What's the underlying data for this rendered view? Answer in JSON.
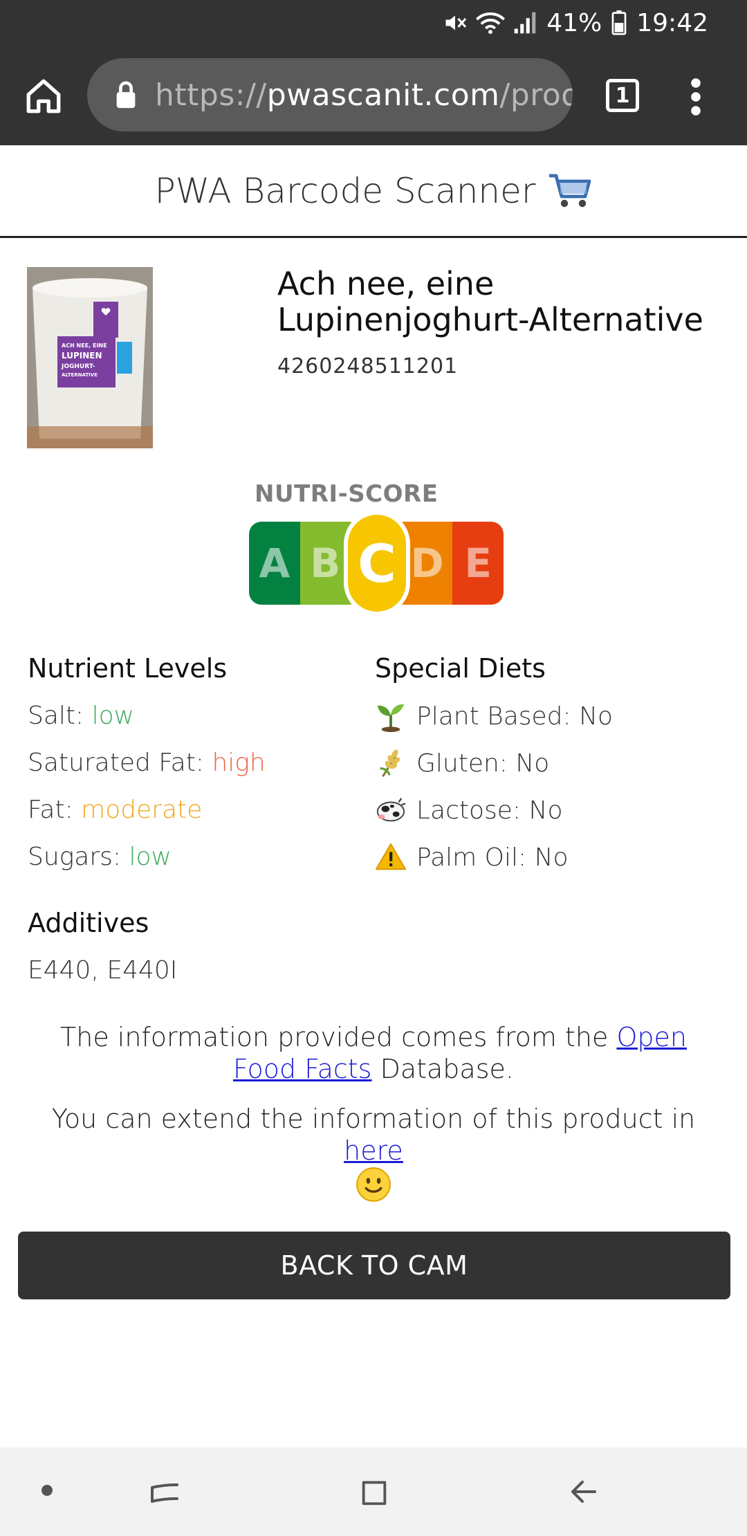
{
  "status_bar": {
    "battery": "41%",
    "time": "19:42"
  },
  "browser": {
    "url_scheme": "https://",
    "url_host": "pwascanit.com",
    "url_path": "/prod",
    "tab_count": "1"
  },
  "app": {
    "title": "PWA Barcode Scanner"
  },
  "product": {
    "name": "Ach nee, eine Lupinenjoghurt-Alternative",
    "code": "4260248511201",
    "thumb_text": "ACH NEE, EINE LUPINEN JOGHURT-ALTERNATIVE"
  },
  "nutriscore": {
    "label": "NUTRI-SCORE",
    "grades": [
      "A",
      "B",
      "C",
      "D",
      "E"
    ],
    "active": "C",
    "colors": [
      "#038141",
      "#85bb2f",
      "#fecb02",
      "#ee8100",
      "#e63e11"
    ]
  },
  "nutrient_levels": {
    "heading": "Nutrient Levels",
    "items": [
      {
        "label": "Salt:",
        "value": "low"
      },
      {
        "label": "Saturated Fat:",
        "value": "high"
      },
      {
        "label": "Fat:",
        "value": "moderate"
      },
      {
        "label": "Sugars:",
        "value": "low"
      }
    ]
  },
  "special_diets": {
    "heading": "Special Diets",
    "items": [
      {
        "icon": "seedling-icon",
        "text": "Plant Based: No"
      },
      {
        "icon": "wheat-icon",
        "text": "Gluten: No"
      },
      {
        "icon": "cow-icon",
        "text": "Lactose: No"
      },
      {
        "icon": "warning-icon",
        "text": "Palm Oil: No"
      }
    ]
  },
  "additives": {
    "heading": "Additives",
    "value": "E440, E440I"
  },
  "info": {
    "source_prefix": "The information provided comes from the ",
    "source_link": "Open Food Facts",
    "source_suffix": " Database.",
    "extend_prefix": "You can extend the information of this product in ",
    "extend_link": "here"
  },
  "actions": {
    "back_label": "BACK TO CAM"
  },
  "colors": {
    "chrome": "#333333",
    "level_low": "#3caa5a",
    "level_high": "#e8664a",
    "level_moderate": "#f2a51a",
    "link": "#1a1ad6"
  }
}
